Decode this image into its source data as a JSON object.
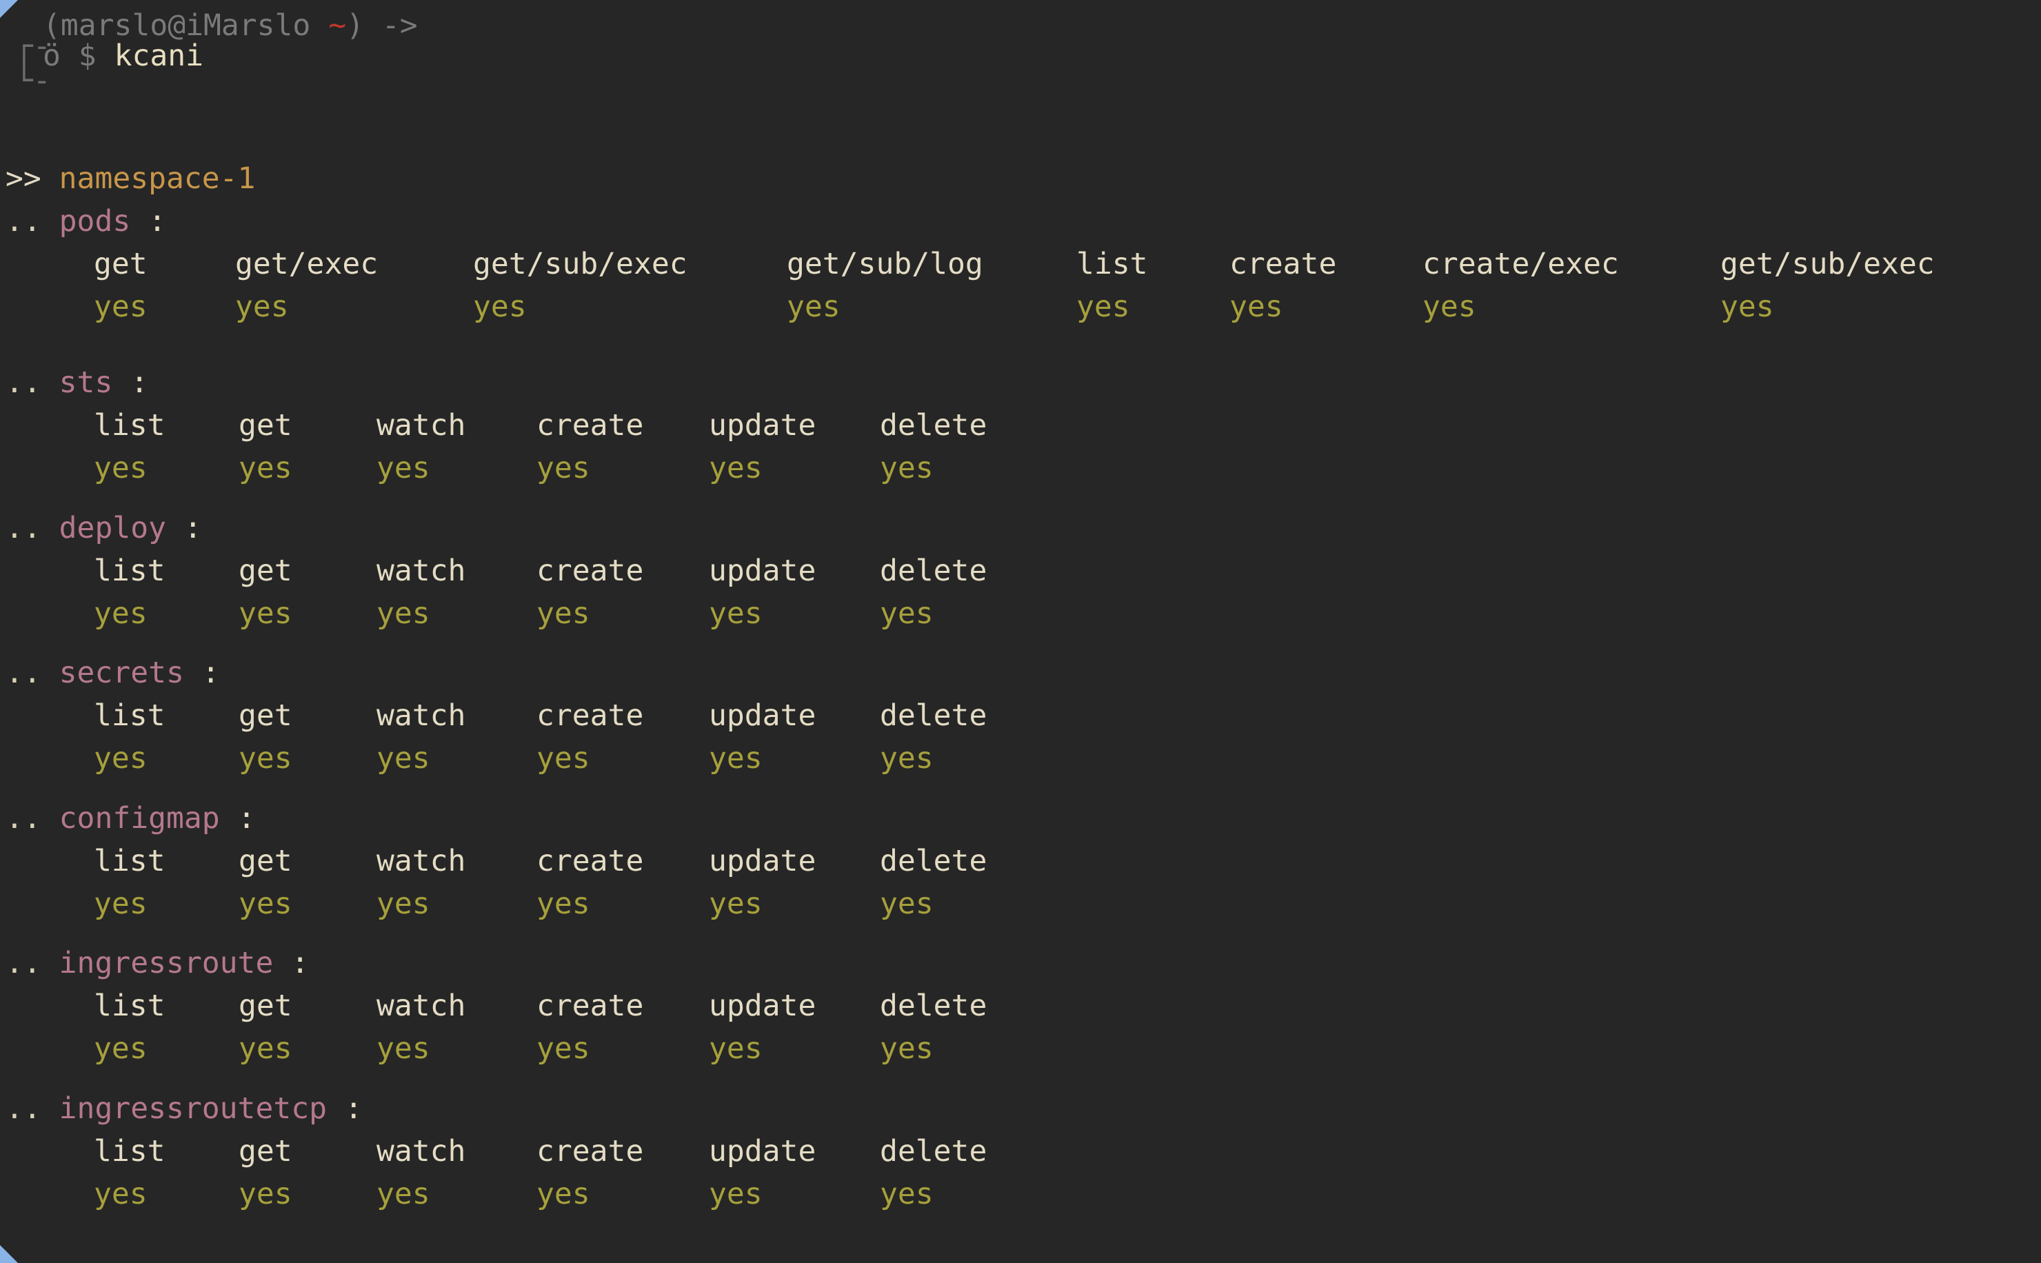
{
  "terminal": {
    "background_color": "#262626",
    "accent_color": "#8ab4e8",
    "header_text_color": "#e4dcc4",
    "value_color": "#a6a03c",
    "resource_color": "#b5788f",
    "namespace_color": "#c8964a"
  },
  "prompt": {
    "bracket_top": "┌",
    "bracket_bottom": "└",
    "dash": "-",
    "open_paren": "(",
    "user_host": "marslo@iMarslo",
    "tilde": "~",
    "close_paren": ")",
    "arrow": "->",
    "face": "ö",
    "sigil": "$",
    "command": "kcani"
  },
  "output": {
    "namespace_marker": ">>",
    "namespace": "namespace-1",
    "resource_marker": "..",
    "colon": ":",
    "sections": [
      {
        "name": "pods",
        "verbs": [
          "get",
          "get/exec",
          "get/sub/exec",
          "get/sub/log",
          "list",
          "create",
          "create/exec",
          "get/sub/exec"
        ],
        "values": [
          "yes",
          "yes",
          "yes",
          "yes",
          "yes",
          "yes",
          "yes",
          "yes"
        ]
      },
      {
        "name": "sts",
        "verbs": [
          "list",
          "get",
          "watch",
          "create",
          "update",
          "delete"
        ],
        "values": [
          "yes",
          "yes",
          "yes",
          "yes",
          "yes",
          "yes"
        ]
      },
      {
        "name": "deploy",
        "verbs": [
          "list",
          "get",
          "watch",
          "create",
          "update",
          "delete"
        ],
        "values": [
          "yes",
          "yes",
          "yes",
          "yes",
          "yes",
          "yes"
        ]
      },
      {
        "name": "secrets",
        "verbs": [
          "list",
          "get",
          "watch",
          "create",
          "update",
          "delete"
        ],
        "values": [
          "yes",
          "yes",
          "yes",
          "yes",
          "yes",
          "yes"
        ]
      },
      {
        "name": "configmap",
        "verbs": [
          "list",
          "get",
          "watch",
          "create",
          "update",
          "delete"
        ],
        "values": [
          "yes",
          "yes",
          "yes",
          "yes",
          "yes",
          "yes"
        ]
      },
      {
        "name": "ingressroute",
        "verbs": [
          "list",
          "get",
          "watch",
          "create",
          "update",
          "delete"
        ],
        "values": [
          "yes",
          "yes",
          "yes",
          "yes",
          "yes",
          "yes"
        ]
      },
      {
        "name": "ingressroutetcp",
        "verbs": [
          "list",
          "get",
          "watch",
          "create",
          "update",
          "delete"
        ],
        "values": [
          "yes",
          "yes",
          "yes",
          "yes",
          "yes",
          "yes"
        ]
      }
    ]
  }
}
